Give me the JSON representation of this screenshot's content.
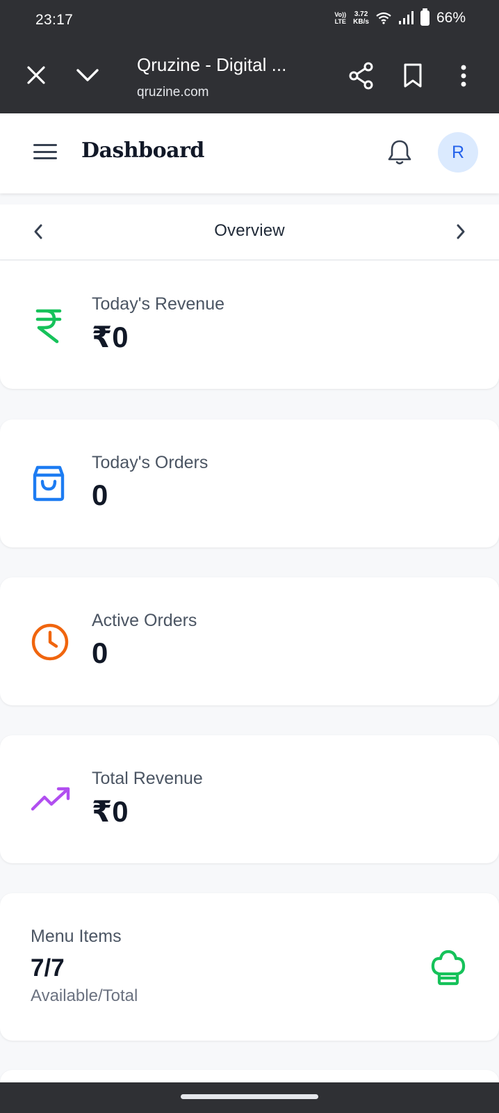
{
  "status_bar": {
    "time": "23:17",
    "volte_line1": "Vo))",
    "volte_line2": "LTE",
    "speed_value": "3.72",
    "speed_unit": "KB/s",
    "battery_percent": "66%"
  },
  "custom_tab": {
    "title": "Qruzine - Digital ...",
    "url": "qruzine.com"
  },
  "header": {
    "title": "Dashboard",
    "avatar_initial": "R"
  },
  "overview": {
    "title": "Overview"
  },
  "cards": [
    {
      "label": "Today's Revenue",
      "value": "₹0",
      "icon": "rupee-icon",
      "color": "#16c25a"
    },
    {
      "label": "Today's Orders",
      "value": "0",
      "icon": "shopping-bag-icon",
      "color": "#1d7cf2"
    },
    {
      "label": "Active Orders",
      "value": "0",
      "icon": "clock-icon",
      "color": "#f0650e"
    },
    {
      "label": "Total Revenue",
      "value": "₹0",
      "icon": "trending-up-icon",
      "color": "#b14ef0"
    }
  ],
  "menu_card": {
    "label": "Menu Items",
    "value": "7/7",
    "sub": "Available/Total",
    "icon": "chef-hat-icon",
    "color": "#16c25a"
  }
}
